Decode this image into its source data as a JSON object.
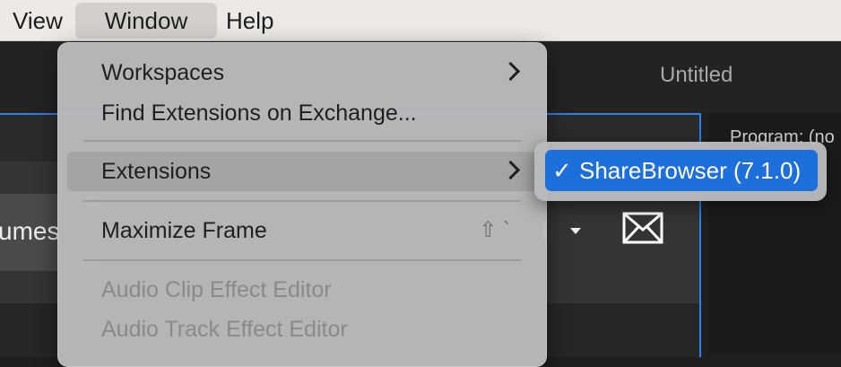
{
  "menubar": {
    "items": [
      "View",
      "Window",
      "Help"
    ]
  },
  "document": {
    "title": "Untitled"
  },
  "panel": {
    "volumes_label": "umes",
    "dropdown_fragment": "l",
    "program_label": "Program: (no"
  },
  "window_menu": {
    "items": [
      {
        "label": "Workspaces",
        "has_submenu": true
      },
      {
        "label": "Find Extensions on Exchange..."
      },
      {
        "label": "Extensions",
        "has_submenu": true,
        "highlighted": true
      },
      {
        "label": "Maximize Frame",
        "shortcut": "⇧ `"
      },
      {
        "label": "Audio Clip Effect Editor",
        "disabled": true
      },
      {
        "label": "Audio Track Effect Editor",
        "disabled": true
      }
    ]
  },
  "extensions_submenu": {
    "items": [
      {
        "check": "✓",
        "label": "ShareBrowser (7.1.0)",
        "checked": true
      }
    ]
  },
  "colors": {
    "accent": "#1d6fdc",
    "panel_border": "#2f7fe8"
  }
}
